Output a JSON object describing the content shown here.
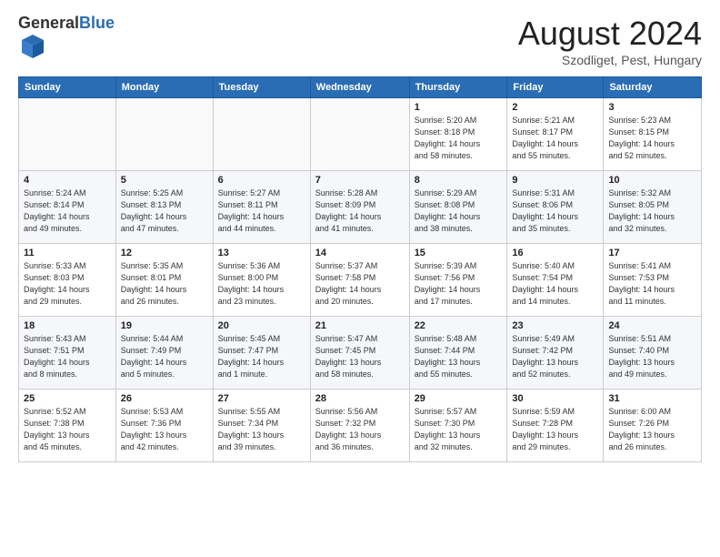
{
  "logo": {
    "general": "General",
    "blue": "Blue"
  },
  "header": {
    "month": "August 2024",
    "location": "Szodliget, Pest, Hungary"
  },
  "weekdays": [
    "Sunday",
    "Monday",
    "Tuesday",
    "Wednesday",
    "Thursday",
    "Friday",
    "Saturday"
  ],
  "weeks": [
    [
      {
        "day": "",
        "info": ""
      },
      {
        "day": "",
        "info": ""
      },
      {
        "day": "",
        "info": ""
      },
      {
        "day": "",
        "info": ""
      },
      {
        "day": "1",
        "info": "Sunrise: 5:20 AM\nSunset: 8:18 PM\nDaylight: 14 hours\nand 58 minutes."
      },
      {
        "day": "2",
        "info": "Sunrise: 5:21 AM\nSunset: 8:17 PM\nDaylight: 14 hours\nand 55 minutes."
      },
      {
        "day": "3",
        "info": "Sunrise: 5:23 AM\nSunset: 8:15 PM\nDaylight: 14 hours\nand 52 minutes."
      }
    ],
    [
      {
        "day": "4",
        "info": "Sunrise: 5:24 AM\nSunset: 8:14 PM\nDaylight: 14 hours\nand 49 minutes."
      },
      {
        "day": "5",
        "info": "Sunrise: 5:25 AM\nSunset: 8:13 PM\nDaylight: 14 hours\nand 47 minutes."
      },
      {
        "day": "6",
        "info": "Sunrise: 5:27 AM\nSunset: 8:11 PM\nDaylight: 14 hours\nand 44 minutes."
      },
      {
        "day": "7",
        "info": "Sunrise: 5:28 AM\nSunset: 8:09 PM\nDaylight: 14 hours\nand 41 minutes."
      },
      {
        "day": "8",
        "info": "Sunrise: 5:29 AM\nSunset: 8:08 PM\nDaylight: 14 hours\nand 38 minutes."
      },
      {
        "day": "9",
        "info": "Sunrise: 5:31 AM\nSunset: 8:06 PM\nDaylight: 14 hours\nand 35 minutes."
      },
      {
        "day": "10",
        "info": "Sunrise: 5:32 AM\nSunset: 8:05 PM\nDaylight: 14 hours\nand 32 minutes."
      }
    ],
    [
      {
        "day": "11",
        "info": "Sunrise: 5:33 AM\nSunset: 8:03 PM\nDaylight: 14 hours\nand 29 minutes."
      },
      {
        "day": "12",
        "info": "Sunrise: 5:35 AM\nSunset: 8:01 PM\nDaylight: 14 hours\nand 26 minutes."
      },
      {
        "day": "13",
        "info": "Sunrise: 5:36 AM\nSunset: 8:00 PM\nDaylight: 14 hours\nand 23 minutes."
      },
      {
        "day": "14",
        "info": "Sunrise: 5:37 AM\nSunset: 7:58 PM\nDaylight: 14 hours\nand 20 minutes."
      },
      {
        "day": "15",
        "info": "Sunrise: 5:39 AM\nSunset: 7:56 PM\nDaylight: 14 hours\nand 17 minutes."
      },
      {
        "day": "16",
        "info": "Sunrise: 5:40 AM\nSunset: 7:54 PM\nDaylight: 14 hours\nand 14 minutes."
      },
      {
        "day": "17",
        "info": "Sunrise: 5:41 AM\nSunset: 7:53 PM\nDaylight: 14 hours\nand 11 minutes."
      }
    ],
    [
      {
        "day": "18",
        "info": "Sunrise: 5:43 AM\nSunset: 7:51 PM\nDaylight: 14 hours\nand 8 minutes."
      },
      {
        "day": "19",
        "info": "Sunrise: 5:44 AM\nSunset: 7:49 PM\nDaylight: 14 hours\nand 5 minutes."
      },
      {
        "day": "20",
        "info": "Sunrise: 5:45 AM\nSunset: 7:47 PM\nDaylight: 14 hours\nand 1 minute."
      },
      {
        "day": "21",
        "info": "Sunrise: 5:47 AM\nSunset: 7:45 PM\nDaylight: 13 hours\nand 58 minutes."
      },
      {
        "day": "22",
        "info": "Sunrise: 5:48 AM\nSunset: 7:44 PM\nDaylight: 13 hours\nand 55 minutes."
      },
      {
        "day": "23",
        "info": "Sunrise: 5:49 AM\nSunset: 7:42 PM\nDaylight: 13 hours\nand 52 minutes."
      },
      {
        "day": "24",
        "info": "Sunrise: 5:51 AM\nSunset: 7:40 PM\nDaylight: 13 hours\nand 49 minutes."
      }
    ],
    [
      {
        "day": "25",
        "info": "Sunrise: 5:52 AM\nSunset: 7:38 PM\nDaylight: 13 hours\nand 45 minutes."
      },
      {
        "day": "26",
        "info": "Sunrise: 5:53 AM\nSunset: 7:36 PM\nDaylight: 13 hours\nand 42 minutes."
      },
      {
        "day": "27",
        "info": "Sunrise: 5:55 AM\nSunset: 7:34 PM\nDaylight: 13 hours\nand 39 minutes."
      },
      {
        "day": "28",
        "info": "Sunrise: 5:56 AM\nSunset: 7:32 PM\nDaylight: 13 hours\nand 36 minutes."
      },
      {
        "day": "29",
        "info": "Sunrise: 5:57 AM\nSunset: 7:30 PM\nDaylight: 13 hours\nand 32 minutes."
      },
      {
        "day": "30",
        "info": "Sunrise: 5:59 AM\nSunset: 7:28 PM\nDaylight: 13 hours\nand 29 minutes."
      },
      {
        "day": "31",
        "info": "Sunrise: 6:00 AM\nSunset: 7:26 PM\nDaylight: 13 hours\nand 26 minutes."
      }
    ]
  ]
}
